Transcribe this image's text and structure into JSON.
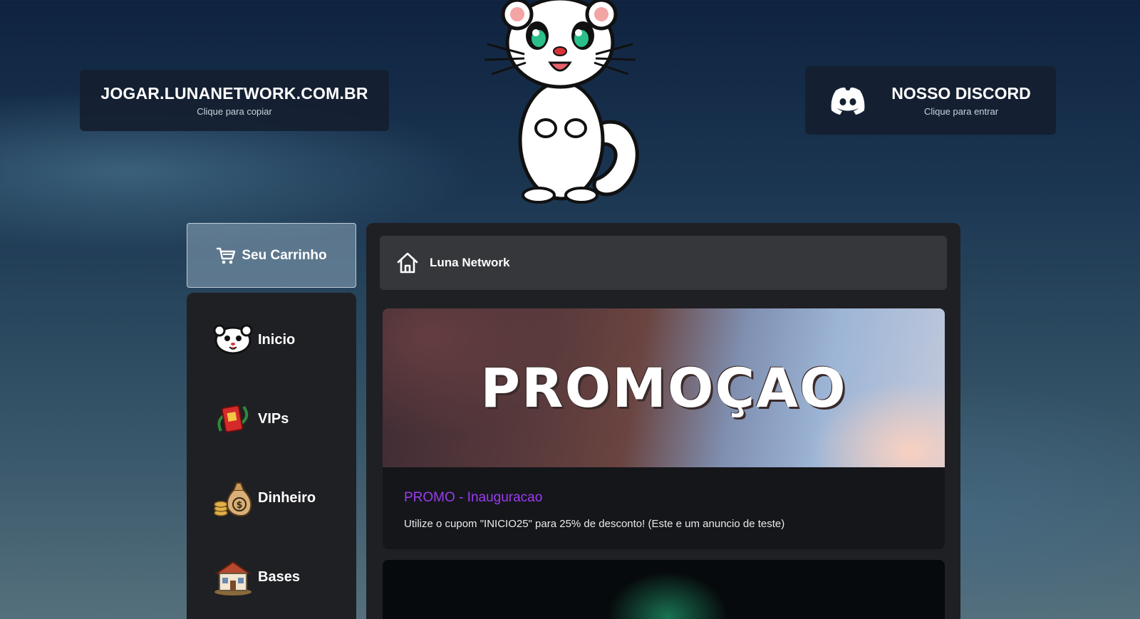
{
  "header": {
    "server_ip": "JOGAR.LUNANETWORK.COM.BR",
    "server_ip_hint": "Clique para copiar",
    "discord_title": "NOSSO DISCORD",
    "discord_hint": "Clique para entrar",
    "logo_icon": "ferret-mascot-icon"
  },
  "cart": {
    "label": "Seu Carrinho",
    "icon": "cart-icon"
  },
  "sidebar": {
    "items": [
      {
        "label": "Inicio",
        "icon": "ferret-face-icon"
      },
      {
        "label": "VIPs",
        "icon": "vip-ticket-icon"
      },
      {
        "label": "Dinheiro",
        "icon": "money-bag-icon"
      },
      {
        "label": "Bases",
        "icon": "house-icon"
      }
    ]
  },
  "breadcrumb": {
    "label": "Luna Network",
    "icon": "home-icon"
  },
  "promo": {
    "banner_text": "PROMOÇAO",
    "title": "PROMO - Inauguracao",
    "description": "Utilize o cupom \"INICIO25\" para 25% de desconto! (Este e um anuncio de teste)"
  },
  "colors": {
    "accent_purple": "#9a3cf0",
    "panel": "#1f2024",
    "breadcrumb_bg": "#35373a",
    "discord_blurple": "#ffffff"
  }
}
